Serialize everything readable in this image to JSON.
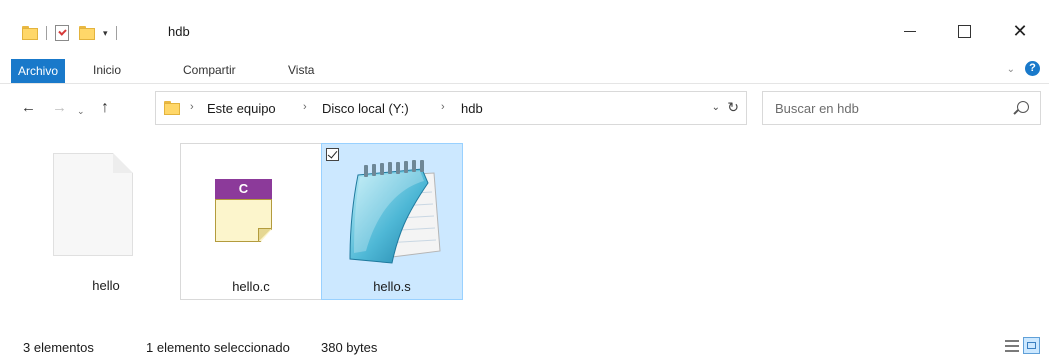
{
  "window": {
    "title": "hdb",
    "minimize_icon": "minimize-icon",
    "maximize_icon": "maximize-icon",
    "close_glyph": "✕"
  },
  "quick_access": {
    "dropdown_glyph": "▾"
  },
  "ribbon": {
    "tabs": [
      {
        "label": "Archivo",
        "active": true
      },
      {
        "label": "Inicio"
      },
      {
        "label": "Compartir"
      },
      {
        "label": "Vista"
      }
    ],
    "collapse_glyph": "⌄",
    "help_glyph": "?"
  },
  "navigation": {
    "back_glyph": "←",
    "forward_glyph": "→",
    "recent_glyph": "⌄",
    "up_glyph": "↑"
  },
  "address": {
    "breadcrumbs": [
      "Este equipo",
      "Disco local (Y:)",
      "hdb"
    ],
    "separator": "›",
    "dropdown_glyph": "⌄",
    "refresh_glyph": "↻"
  },
  "search": {
    "placeholder": "Buscar en hdb"
  },
  "files": [
    {
      "name": "hello",
      "type": "blank-file",
      "selected": false
    },
    {
      "name": "hello.c",
      "type": "c-source",
      "icon_letter": "C",
      "selected": false,
      "hovered": true
    },
    {
      "name": "hello.s",
      "type": "notepad-text",
      "selected": true
    }
  ],
  "status": {
    "count": "3 elementos",
    "selected": "1 elemento seleccionado",
    "size": "380 bytes"
  },
  "colors": {
    "accent": "#1979ca",
    "selection_bg": "#cce8ff",
    "selection_border": "#99d1ff",
    "folder": "#ffd769",
    "c_header": "#8c3a9a",
    "c_body": "#fcf5cc"
  }
}
